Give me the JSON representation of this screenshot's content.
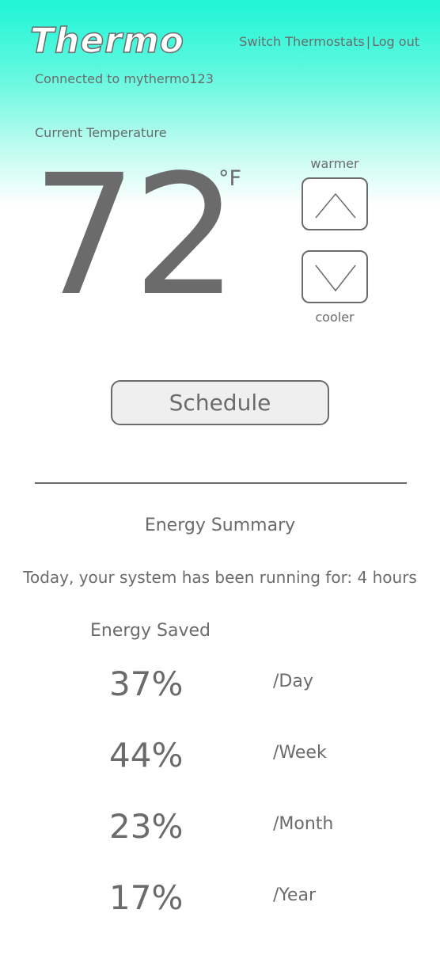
{
  "header": {
    "logo": "Thermo",
    "nav": {
      "switch": "Switch Thermostats",
      "separator": "|",
      "logout": "Log out"
    },
    "connected": "Connected to mythermo123"
  },
  "temperature": {
    "label": "Current Temperature",
    "value": "72",
    "unit": "°F",
    "warmer_label": "warmer",
    "cooler_label": "cooler"
  },
  "schedule_label": "Schedule",
  "energy": {
    "title": "Energy Summary",
    "running": "Today, your system has been running for: 4 hours",
    "saved_title": "Energy Saved",
    "rows": [
      {
        "value": "37%",
        "period": "/Day"
      },
      {
        "value": "44%",
        "period": "/Week"
      },
      {
        "value": "23%",
        "period": "/Month"
      },
      {
        "value": "17%",
        "period": "/Year"
      }
    ]
  },
  "colors": {
    "accent_gradient_top": "#1ff5d6",
    "text": "#6b6b6b",
    "button_fill": "#efefef"
  }
}
